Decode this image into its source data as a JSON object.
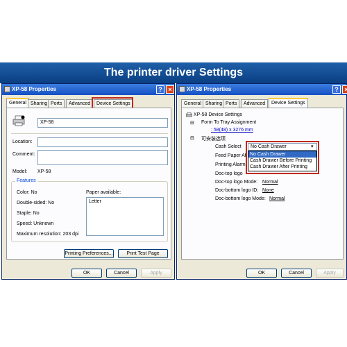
{
  "banner": {
    "title": "The printer driver Settings"
  },
  "left": {
    "title": "XP-58 Properties",
    "tabs": [
      "General",
      "Sharing",
      "Ports",
      "Advanced",
      "Device Settings"
    ],
    "printer_name": "XP-58",
    "location_label": "Location:",
    "comment_label": "Comment:",
    "model_label": "Model:",
    "model_value": "XP-58",
    "features_label": "Features",
    "color": "Color: No",
    "double_sided": "Double-sided: No",
    "staple": "Staple: No",
    "speed": "Speed: Unknown",
    "max_res": "Maximum resolution: 203 dpi",
    "paper_label": "Paper available:",
    "paper_items": [
      "Letter"
    ],
    "printing_prefs": "Printing Preferences...",
    "print_test": "Print Test Page",
    "ok": "OK",
    "cancel": "Cancel",
    "apply": "Apply"
  },
  "right": {
    "title": "XP-58 Properties",
    "tabs": [
      "General",
      "Sharing",
      "Ports",
      "Advanced",
      "Device Settings"
    ],
    "tree": {
      "root": "XP-58 Device Settings",
      "form_tray": "Form To Tray Assignment",
      "form_value": ": 58(48) x 3276 mm",
      "options": "可安装选项",
      "cash_select": "Cash Select",
      "feed_paper": "Feed Paper Af",
      "printing_alarm": "Printing Alarm",
      "doc_top_logo": "Doc-top logo",
      "doc_top_mode_label": "Doc-top logo Mode:",
      "doc_top_mode_value": "Normal",
      "doc_bottom_id_label": "Doc-bottom logo ID:",
      "doc_bottom_id_value": "None",
      "doc_bottom_mode_label": "Doc-bottom logo Mode:",
      "doc_bottom_mode_value": "Normal"
    },
    "dropdown_value": "No Cash Drawer",
    "dropdown_options": [
      "No Cash Drawer",
      "Cash Drawer Before Printing",
      "Cash Drawer After Printing"
    ],
    "ok": "OK",
    "cancel": "Cancel",
    "apply": "Apply"
  }
}
